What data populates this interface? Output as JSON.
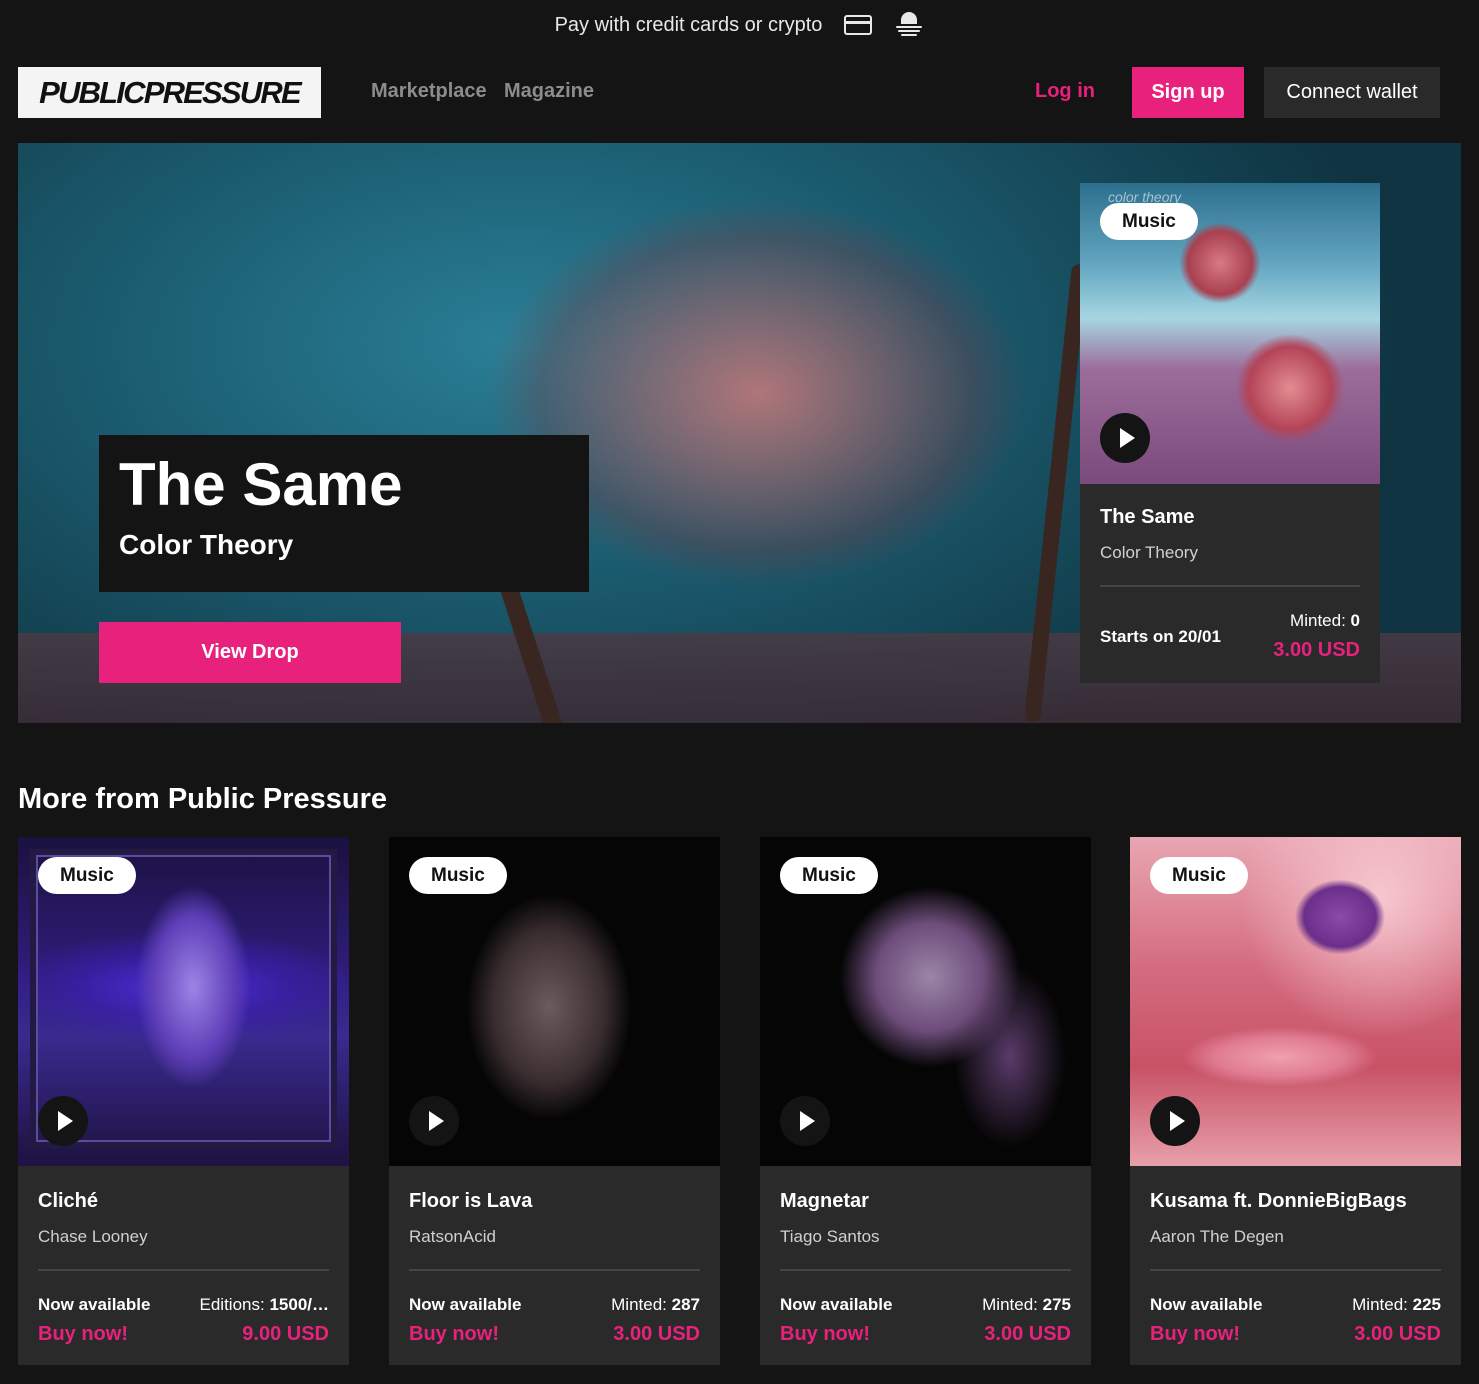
{
  "promo": {
    "text": "Pay with credit cards or crypto",
    "icons": [
      "credit-card-icon",
      "crypto-icon"
    ]
  },
  "nav": {
    "logo": "PUBLICPRESSURE",
    "links": [
      "Marketplace",
      "Magazine"
    ],
    "login": "Log in",
    "signup": "Sign up",
    "connect_wallet": "Connect wallet"
  },
  "hero": {
    "title": "The Same",
    "subtitle": "Color Theory",
    "cta": "View Drop",
    "featured": {
      "badge": "Music",
      "art_caption": "color theory",
      "name": "The Same",
      "artist": "Color Theory",
      "starts": "Starts on 20/01",
      "minted_label": "Minted:",
      "minted_value": "0",
      "price": "3.00 USD"
    }
  },
  "section": {
    "title": "More from Public Pressure"
  },
  "cards": [
    {
      "badge": "Music",
      "name": "Cliché",
      "artist": "Chase Looney",
      "status": "Now available",
      "action": "Buy now!",
      "stat_label": "Editions:",
      "stat_value": "1500/…",
      "price": "9.00 USD"
    },
    {
      "badge": "Music",
      "name": "Floor is Lava",
      "artist": "RatsonAcid",
      "status": "Now available",
      "action": "Buy now!",
      "stat_label": "Minted:",
      "stat_value": "287",
      "price": "3.00 USD"
    },
    {
      "badge": "Music",
      "name": "Magnetar",
      "artist": "Tiago Santos",
      "status": "Now available",
      "action": "Buy now!",
      "stat_label": "Minted:",
      "stat_value": "275",
      "price": "3.00 USD"
    },
    {
      "badge": "Music",
      "name": "Kusama ft. DonnieBigBags",
      "artist": "Aaron The Degen",
      "status": "Now available",
      "action": "Buy now!",
      "stat_label": "Minted:",
      "stat_value": "225",
      "price": "3.00 USD"
    }
  ],
  "colors": {
    "background": "#151415",
    "accent": "#e8217d",
    "card": "#2a2a2a"
  }
}
